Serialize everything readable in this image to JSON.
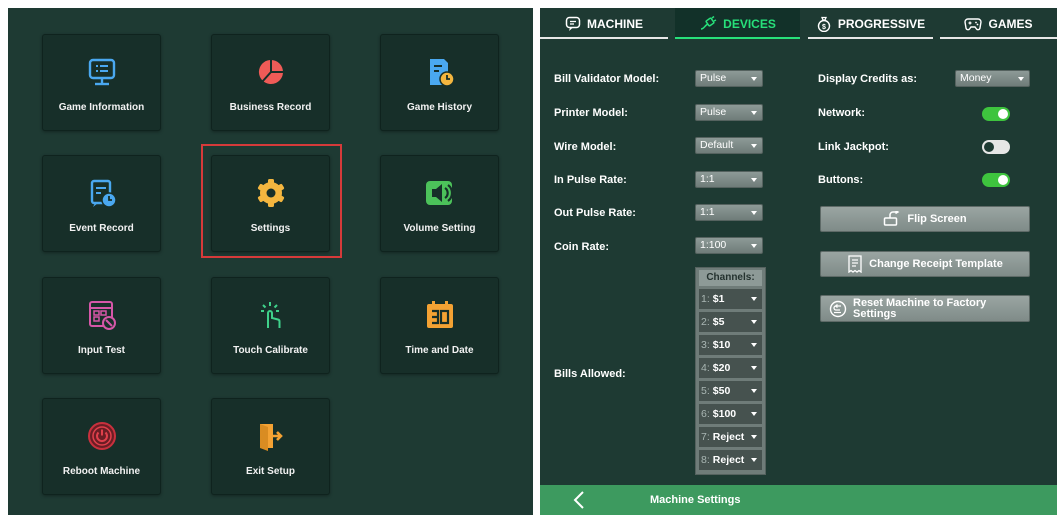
{
  "setup_menu": {
    "tiles": [
      {
        "label": "Game Information",
        "icon": "monitor-list-icon"
      },
      {
        "label": "Business Record",
        "icon": "pie-chart-icon"
      },
      {
        "label": "Game History",
        "icon": "document-clock-icon"
      },
      {
        "label": "Event Record",
        "icon": "calendar-clock-icon"
      },
      {
        "label": "Settings",
        "icon": "gear-icon"
      },
      {
        "label": "Volume Setting",
        "icon": "speaker-icon"
      },
      {
        "label": "Input Test",
        "icon": "keypad-test-icon"
      },
      {
        "label": "Touch Calibrate",
        "icon": "touch-hand-icon"
      },
      {
        "label": "Time and Date",
        "icon": "calendar-icon"
      },
      {
        "label": "Reboot Machine",
        "icon": "power-icon"
      },
      {
        "label": "Exit Setup",
        "icon": "exit-door-icon"
      }
    ]
  },
  "tabs": [
    {
      "label": "MACHINE",
      "icon": "chat-bubble-icon",
      "active": false
    },
    {
      "label": "DEVICES",
      "icon": "devices-icon",
      "active": true
    },
    {
      "label": "PROGRESSIVE",
      "icon": "money-bag-icon",
      "active": false
    },
    {
      "label": "GAMES",
      "icon": "gamepad-icon",
      "active": false
    }
  ],
  "devices": {
    "bill_validator_model": {
      "label": "Bill Validator Model:",
      "value": "Pulse"
    },
    "printer_model": {
      "label": "Printer Model:",
      "value": "Pulse"
    },
    "wire_model": {
      "label": "Wire Model:",
      "value": "Default"
    },
    "in_pulse_rate": {
      "label": "In Pulse Rate:",
      "value": "1:1"
    },
    "out_pulse_rate": {
      "label": "Out Pulse Rate:",
      "value": "1:1"
    },
    "coin_rate": {
      "label": "Coin Rate:",
      "value": "1:100"
    },
    "bills_allowed": {
      "label": "Bills Allowed:",
      "channels_header": "Channels:",
      "channels": [
        {
          "num": "1:",
          "value": "$1"
        },
        {
          "num": "2:",
          "value": "$5"
        },
        {
          "num": "3:",
          "value": "$10"
        },
        {
          "num": "4:",
          "value": "$20"
        },
        {
          "num": "5:",
          "value": "$50"
        },
        {
          "num": "6:",
          "value": "$100"
        },
        {
          "num": "7:",
          "value": "Reject"
        },
        {
          "num": "8:",
          "value": "Reject"
        }
      ]
    },
    "display_credits_as": {
      "label": "Display Credits as:",
      "value": "Money"
    },
    "network": {
      "label": "Network:",
      "on": true
    },
    "link_jackpot": {
      "label": "Link Jackpot:",
      "on": false
    },
    "buttons": {
      "label": "Buttons:",
      "on": true
    },
    "flip_screen_label": "Flip Screen",
    "change_receipt_label": "Change Receipt Template",
    "reset_factory_label": "Reset Machine to Factory Settings"
  },
  "bottom_bar": {
    "title": "Machine Settings"
  },
  "colors": {
    "panel_bg": "#1e3a33",
    "tile_bg": "#172f29",
    "accent_green": "#27e07a",
    "toggle_on": "#3ec43e",
    "bottom_bar": "#3d9a5f",
    "highlight_red": "#d63a3a"
  }
}
